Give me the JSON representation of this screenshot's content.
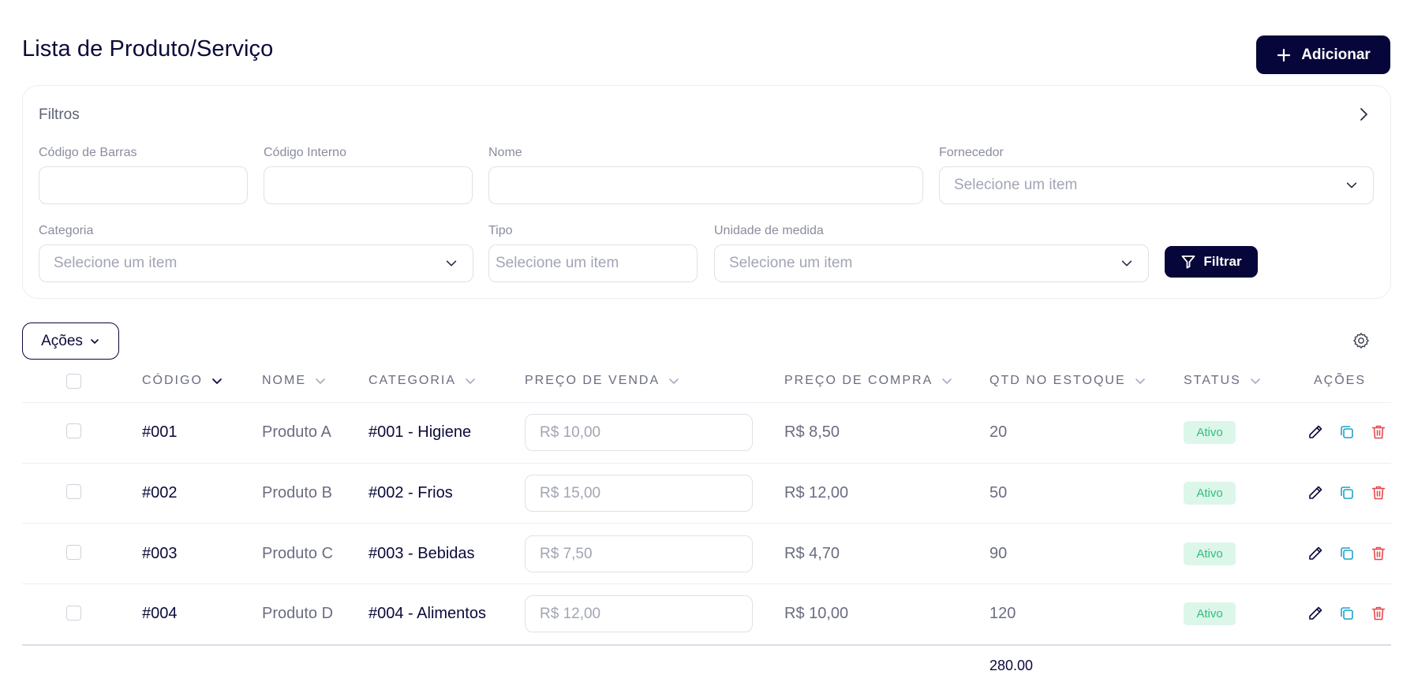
{
  "page": {
    "title": "Lista de Produto/Serviço"
  },
  "header": {
    "add_label": "Adicionar"
  },
  "filters": {
    "title": "Filtros",
    "barcode_label": "Código de Barras",
    "internal_code_label": "Código Interno",
    "name_label": "Nome",
    "supplier_label": "Fornecedor",
    "supplier_placeholder": "Selecione um item",
    "category_label": "Categoria",
    "category_placeholder": "Selecione um item",
    "type_label": "Tipo",
    "type_placeholder": "Selecione um item",
    "unit_label": "Unidade de medida",
    "unit_placeholder": "Selecione um item",
    "filter_button": "Filtrar"
  },
  "toolbar": {
    "actions_label": "Ações",
    "settings_icon": "gear-icon"
  },
  "table": {
    "columns": {
      "code": "CÓDIGO",
      "name": "NOME",
      "category": "CATEGORIA",
      "sale_price": "PREÇO DE VENDA",
      "purchase_price": "PREÇO DE COMPRA",
      "stock": "QTD NO ESTOQUE",
      "status": "STATUS",
      "actions": "AÇÕES"
    },
    "rows": [
      {
        "code": "#001",
        "name": "Produto A",
        "category": "#001 - Higiene",
        "sale_price": "R$ 10,00",
        "purchase_price": "R$ 8,50",
        "stock": "20",
        "status": "Ativo"
      },
      {
        "code": "#002",
        "name": "Produto B",
        "category": "#002 - Frios",
        "sale_price": "R$ 15,00",
        "purchase_price": "R$ 12,00",
        "stock": "50",
        "status": "Ativo"
      },
      {
        "code": "#003",
        "name": "Produto C",
        "category": "#003 - Bebidas",
        "sale_price": "R$ 7,50",
        "purchase_price": "R$ 4,70",
        "stock": "90",
        "status": "Ativo"
      },
      {
        "code": "#004",
        "name": "Produto D",
        "category": "#004 - Alimentos",
        "sale_price": "R$ 12,00",
        "purchase_price": "R$ 10,00",
        "stock": "120",
        "status": "Ativo"
      }
    ],
    "stock_total": "280.00"
  },
  "colors": {
    "primary": "#07063a",
    "status_active_bg": "#dcf6ea",
    "status_active_text": "#2fbf7c",
    "edit_icon": "#0b0a3b",
    "copy_icon": "#1aa3c9",
    "delete_icon": "#e5484d"
  }
}
